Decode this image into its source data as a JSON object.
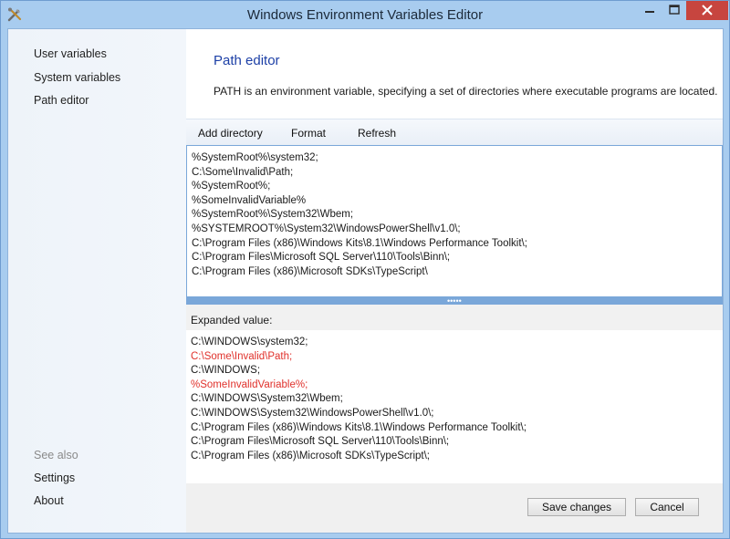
{
  "window": {
    "title": "Windows Environment Variables Editor",
    "accent_color": "#a8ccef",
    "close_color": "#c7453f"
  },
  "sidebar": {
    "items": [
      {
        "label": "User variables"
      },
      {
        "label": "System variables"
      },
      {
        "label": "Path editor"
      }
    ],
    "see_also_label": "See also",
    "footer_items": [
      {
        "label": "Settings"
      },
      {
        "label": "About"
      }
    ]
  },
  "main": {
    "title": "Path editor",
    "description": "PATH is an environment variable, specifying a set of directories where executable programs are located.",
    "toolbar": {
      "add_directory": "Add directory",
      "format": "Format",
      "refresh": "Refresh"
    },
    "editor_lines": [
      "%SystemRoot%\\system32;",
      "C:\\Some\\Invalid\\Path;",
      "%SystemRoot%;",
      "%SomeInvalidVariable%",
      "%SystemRoot%\\System32\\Wbem;",
      "%SYSTEMROOT%\\System32\\WindowsPowerShell\\v1.0\\;",
      "C:\\Program Files (x86)\\Windows Kits\\8.1\\Windows Performance Toolkit\\;",
      "C:\\Program Files\\Microsoft SQL Server\\110\\Tools\\Binn\\;",
      "C:\\Program Files (x86)\\Microsoft SDKs\\TypeScript\\"
    ],
    "splitter_grip": "•••••",
    "expanded_label": "Expanded value:",
    "expanded_lines": [
      {
        "text": "C:\\WINDOWS\\system32;",
        "invalid": false
      },
      {
        "text": "C:\\Some\\Invalid\\Path;",
        "invalid": true
      },
      {
        "text": "C:\\WINDOWS;",
        "invalid": false
      },
      {
        "text": "%SomeInvalidVariable%;",
        "invalid": true
      },
      {
        "text": "C:\\WINDOWS\\System32\\Wbem;",
        "invalid": false
      },
      {
        "text": "C:\\WINDOWS\\System32\\WindowsPowerShell\\v1.0\\;",
        "invalid": false
      },
      {
        "text": "C:\\Program Files (x86)\\Windows Kits\\8.1\\Windows Performance Toolkit\\;",
        "invalid": false
      },
      {
        "text": "C:\\Program Files\\Microsoft SQL Server\\110\\Tools\\Binn\\;",
        "invalid": false
      },
      {
        "text": "C:\\Program Files (x86)\\Microsoft SDKs\\TypeScript\\;",
        "invalid": false
      }
    ],
    "invalid_color": "#e0312b",
    "buttons": {
      "save": "Save changes",
      "cancel": "Cancel"
    }
  }
}
